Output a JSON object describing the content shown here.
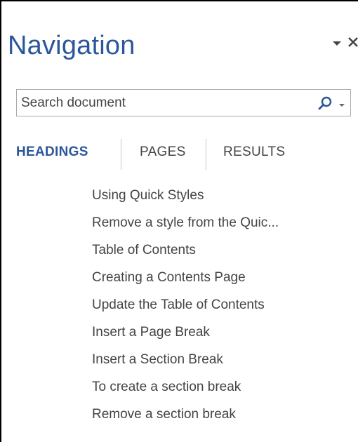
{
  "pane": {
    "title": "Navigation",
    "options_icon": "chevron-down-icon",
    "close_icon": "close-icon"
  },
  "search": {
    "placeholder": "Search document",
    "value": "",
    "search_icon": "magnifier-icon",
    "dropdown_icon": "chevron-down-icon"
  },
  "tabs": [
    {
      "label": "HEADINGS",
      "active": true
    },
    {
      "label": "PAGES",
      "active": false
    },
    {
      "label": "RESULTS",
      "active": false
    }
  ],
  "headings": [
    {
      "label": "Using Quick Styles"
    },
    {
      "label": "Remove a style from the Quic..."
    },
    {
      "label": "Table of Contents"
    },
    {
      "label": "Creating a Contents Page"
    },
    {
      "label": "Update the Table of Contents"
    },
    {
      "label": "Insert a Page Break"
    },
    {
      "label": "Insert a Section Break"
    },
    {
      "label": "To create a section break"
    },
    {
      "label": "Remove a section break"
    }
  ],
  "colors": {
    "accent": "#2b579a",
    "text": "#444444",
    "border": "#ababab"
  }
}
